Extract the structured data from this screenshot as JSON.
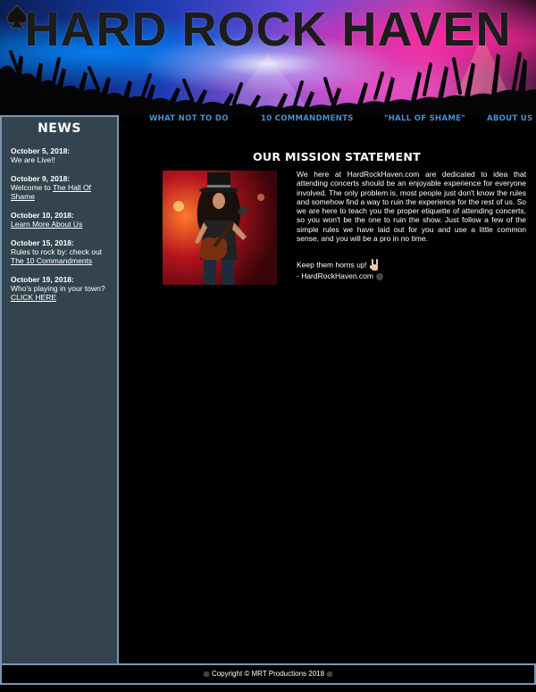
{
  "header": {
    "title": "HARD ROCK HAVEN",
    "logo_icon": "spade-icon"
  },
  "nav": {
    "items": [
      {
        "label": "WHAT NOT TO DO"
      },
      {
        "label": "10 COMMANDMENTS"
      },
      {
        "label": "\"HALL OF SHAME\""
      },
      {
        "label": "ABOUT US"
      }
    ]
  },
  "sidebar": {
    "title": "NEWS",
    "items": [
      {
        "date": "October 5, 2018:",
        "text": "We are Live!!",
        "link": ""
      },
      {
        "date": "October 9, 2018:",
        "text": "Welcome to ",
        "link": "The Hall Of Shame"
      },
      {
        "date": "October 10, 2018:",
        "text": "",
        "link": "Learn More About Us"
      },
      {
        "date": "October 15, 2018:",
        "text": "Rules to rock by: check out",
        "link": "The 10 Commandments"
      },
      {
        "date": "October 19, 2018:",
        "text": "Who's playing in your town?",
        "link": "CLICK HERE"
      }
    ]
  },
  "main": {
    "heading": "OUR MISSION STATEMENT",
    "body": "We here at HardRockHaven.com are dedicated to idea that attending concerts should be an enjoyable experience for everyone involved. The only problem is, most people just don't know the rules and somehow find a way to ruin the experience for the rest of us. So we are here to teach you the proper etiquette of attending concerts, so you won't be the one to ruin the show. Just follow a few of the simple rules we have laid out for you and use a little common sense, and you will be a pro in no time.",
    "signoff_line1": "Keep them horns up!",
    "signoff_line2": "- HardRockHaven.com",
    "photo_icon": "guitarist-photo"
  },
  "footer": {
    "text": "Copyright © MRT Productions 2018"
  },
  "colors": {
    "sidebar_bg": "#33444f",
    "border": "#7a96b0",
    "nav_link": "#4a8fd0",
    "background": "#000000"
  }
}
